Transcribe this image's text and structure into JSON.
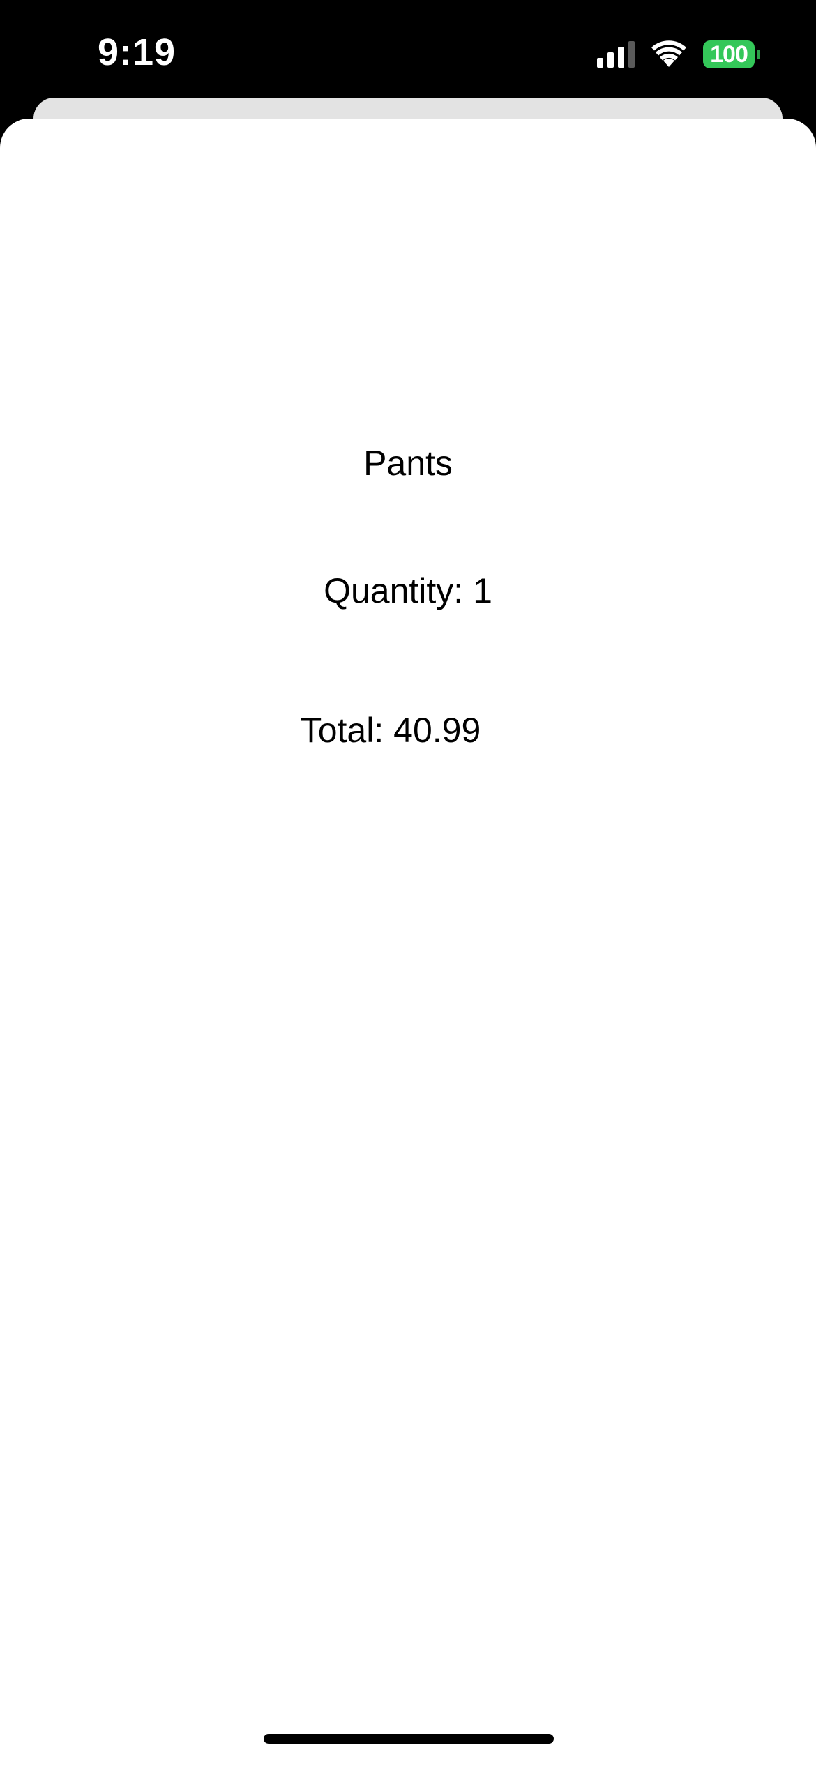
{
  "status_bar": {
    "time": "9:19",
    "battery_level": "100",
    "signal_icon": "cellular-signal-icon",
    "wifi_icon": "wifi-icon",
    "battery_icon": "battery-icon",
    "battery_color": "#34c759"
  },
  "order": {
    "product_name": "Pants",
    "quantity_text": "Quantity: 1",
    "total_text": "Total: 40.99"
  }
}
